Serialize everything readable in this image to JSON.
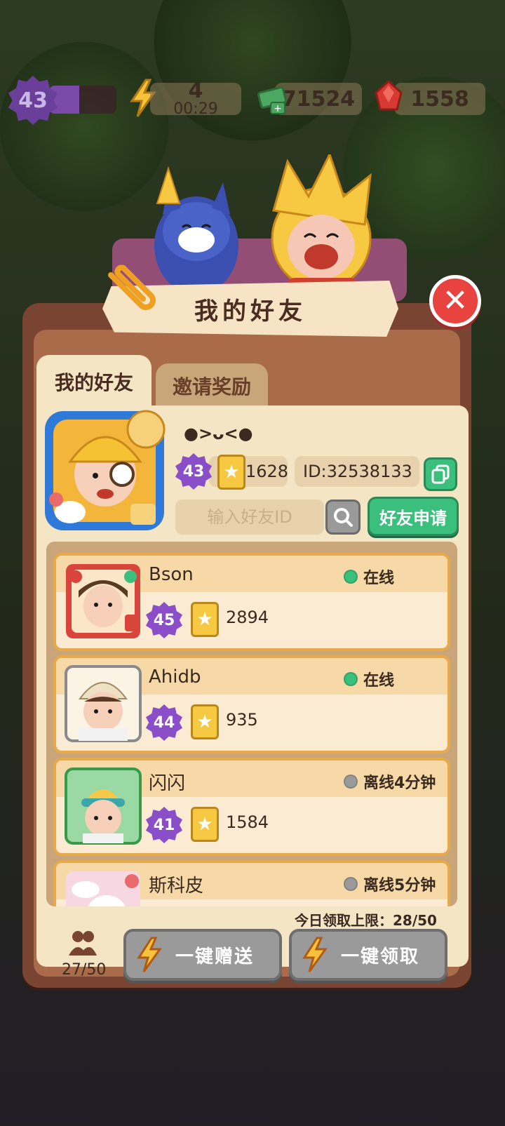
{
  "hud": {
    "level": "43",
    "xp_fraction": 0.45,
    "energy": "4",
    "energy_timer": "00:29",
    "cash": "71524",
    "gems": "1558"
  },
  "dialog": {
    "title": "我的好友",
    "tabs": [
      {
        "label": "我的好友",
        "active": true
      },
      {
        "label": "邀请奖励",
        "active": false
      }
    ]
  },
  "self": {
    "name": "●>ᴗ<●",
    "level": "43",
    "score": "1628",
    "id_text": "ID:32538133"
  },
  "search": {
    "placeholder": "输入好友ID",
    "request_label": "好友申请"
  },
  "friends": [
    {
      "name": "Bson",
      "status": "在线",
      "online": true,
      "level": "45",
      "score": "2894"
    },
    {
      "name": "Ahidb",
      "status": "在线",
      "online": true,
      "level": "44",
      "score": "935"
    },
    {
      "name": "闪闪",
      "status": "离线4分钟",
      "online": false,
      "level": "41",
      "score": "1584"
    },
    {
      "name": "斯科皮",
      "status": "离线5分钟",
      "online": false,
      "level": "",
      "score": ""
    }
  ],
  "footer": {
    "daily_limit": "今日领取上限：28/50",
    "friend_count": "27/50",
    "send_all_label": "一键赠送",
    "claim_all_label": "一键领取"
  },
  "colors": {
    "online": "#3bbf7c",
    "offline": "#9a9a9a",
    "accent_green": "#3bbf7c",
    "close_red": "#e8433e"
  }
}
